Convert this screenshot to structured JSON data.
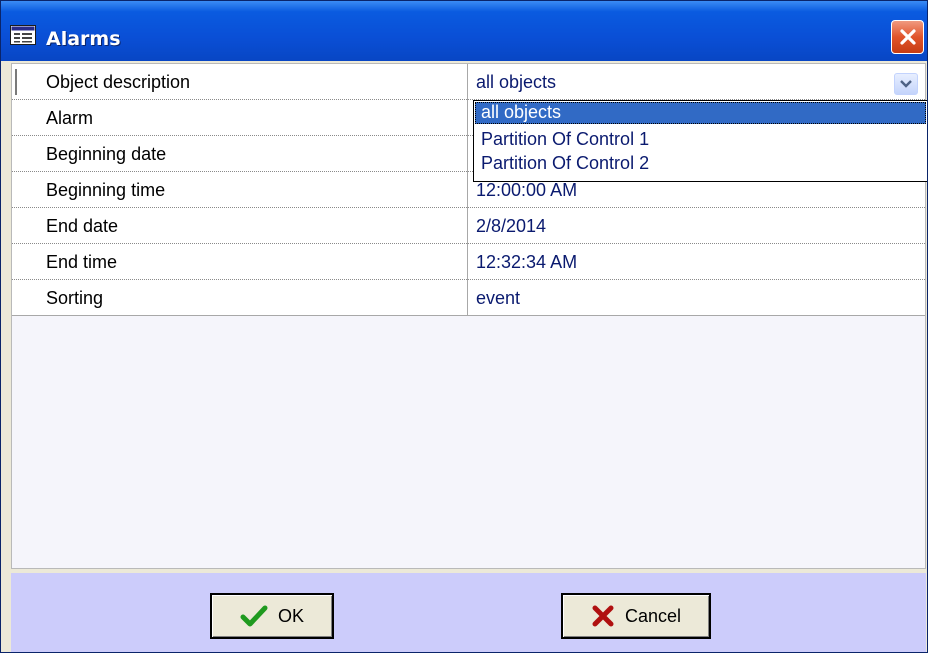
{
  "window": {
    "title": "Alarms",
    "icons": {
      "app": "window-list-icon",
      "close": "close-icon"
    },
    "colors": {
      "titlebar": "#0a4fd6",
      "close": "#e1542b",
      "footer": "#ccccfb",
      "selection": "#316ac5"
    }
  },
  "properties": {
    "rows": [
      {
        "label": "Object description",
        "value": "all objects"
      },
      {
        "label": "Alarm",
        "value": ""
      },
      {
        "label": "Beginning date",
        "value": ""
      },
      {
        "label": "Beginning time",
        "value": "12:00:00 AM"
      },
      {
        "label": "End date",
        "value": "2/8/2014"
      },
      {
        "label": "End time",
        "value": "12:32:34 AM"
      },
      {
        "label": "Sorting",
        "value": "event"
      }
    ]
  },
  "dropdown": {
    "selected": "all objects",
    "options": [
      "all objects",
      "Partition Of Control 1",
      "Partition Of Control 2"
    ],
    "icon": "chevron-down-icon"
  },
  "buttons": {
    "ok": {
      "label": "OK",
      "icon": "checkmark-icon"
    },
    "cancel": {
      "label": "Cancel",
      "icon": "x-cross-icon"
    }
  }
}
